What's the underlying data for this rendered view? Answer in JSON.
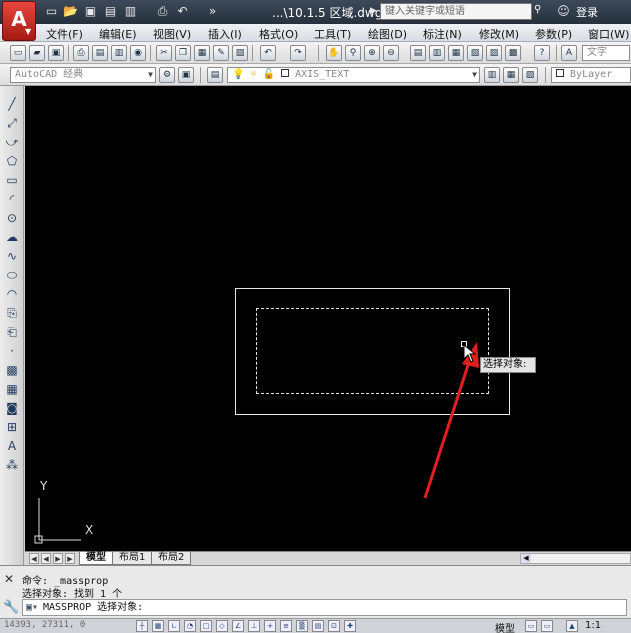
{
  "app": {
    "logo_letter": "A",
    "file_title": "...\\10.1.5 区域.dwg",
    "search_placeholder": "键入关键字或短语",
    "login_label": "登录"
  },
  "menu": [
    "文件(F)",
    "编辑(E)",
    "视图(V)",
    "插入(I)",
    "格式(O)",
    "工具(T)",
    "绘图(D)",
    "标注(N)",
    "修改(M)",
    "参数(P)",
    "窗口(W)"
  ],
  "toolbar": {
    "text_style_value": "文字",
    "workspace_value": "AutoCAD 经典",
    "layer_value": "AXIS_TEXT",
    "color_value": "ByLayer"
  },
  "canvas": {
    "tooltip_text": "选择对象:",
    "ucs_y_label": "Y",
    "ucs_x_label": "X"
  },
  "layout_tabs": [
    "模型",
    "布局1",
    "布局2"
  ],
  "command": {
    "line1": "命令: _massprop",
    "line2": "选择对象: 找到 1 个",
    "input_text": "MASSPROP 选择对象:"
  },
  "status": {
    "coords": "14393, 27311, 0",
    "model_label": "模型",
    "scale_label": "1:1"
  },
  "colors": {
    "canvas_bg": "#000000",
    "arrow": "#e02020",
    "app_button": "#c4221a"
  }
}
